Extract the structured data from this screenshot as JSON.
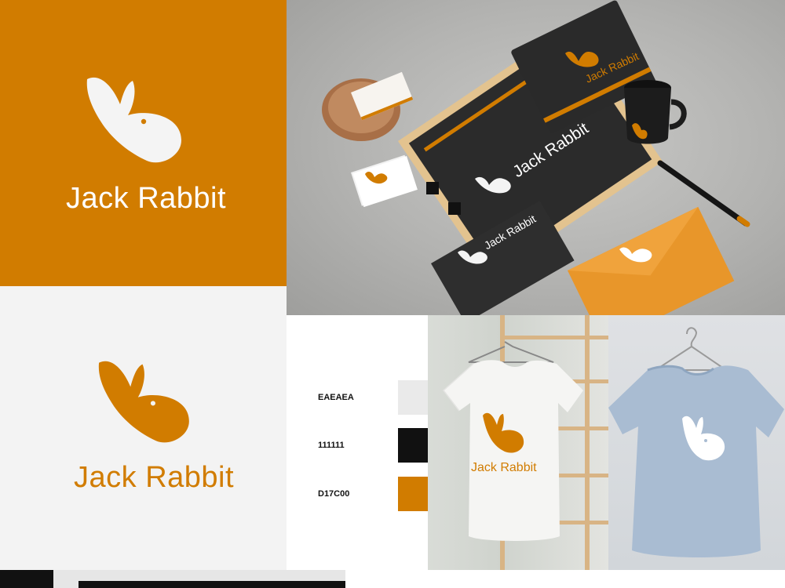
{
  "brand": {
    "name": "Jack Rabbit"
  },
  "colors": {
    "orange": "#D17C00",
    "light": "#EAEAEA",
    "dark": "#111111",
    "white": "#FFFFFF"
  },
  "palette": [
    {
      "code": "EAEAEA",
      "hex": "#EAEAEA"
    },
    {
      "code": "111111",
      "hex": "#111111"
    },
    {
      "code": "D17C00",
      "hex": "#D17C00"
    }
  ],
  "icons": {
    "logo": "rabbit-head-icon"
  }
}
